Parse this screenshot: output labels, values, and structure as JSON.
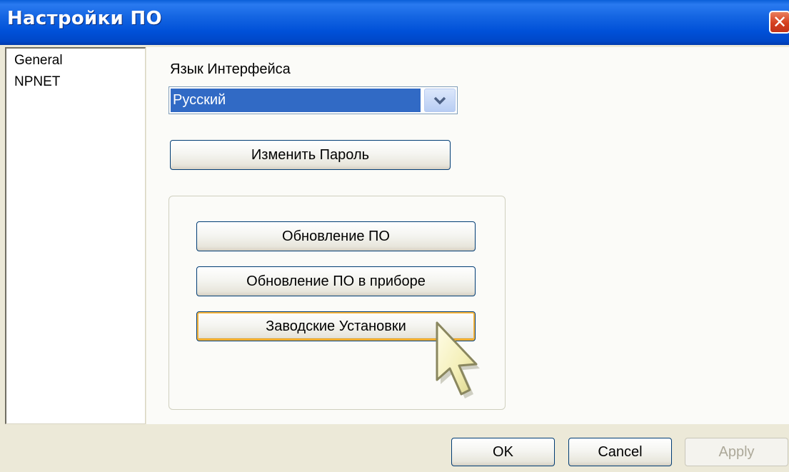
{
  "window": {
    "title": "Настройки ПО",
    "close_label": "✕"
  },
  "sidebar": {
    "items": [
      {
        "label": "General"
      },
      {
        "label": "NPNET"
      }
    ]
  },
  "main": {
    "language_label": "Язык Интерфейса",
    "language_value": "Русский",
    "change_password_label": "Изменить Пароль",
    "update_group": {
      "update_software_label": "Обновление ПО",
      "update_device_software_label": "Обновление ПО в приборе",
      "factory_settings_label": "Заводские Установки"
    }
  },
  "footer": {
    "ok_label": "OK",
    "cancel_label": "Cancel",
    "apply_label": "Apply"
  },
  "colors": {
    "titlebar": "#0050d8",
    "selection": "#316ac5",
    "hover_outline": "#f8b53c"
  },
  "icons": {
    "close": "close-icon",
    "dropdown": "chevron-down-icon",
    "cursor": "mouse-pointer-icon"
  }
}
